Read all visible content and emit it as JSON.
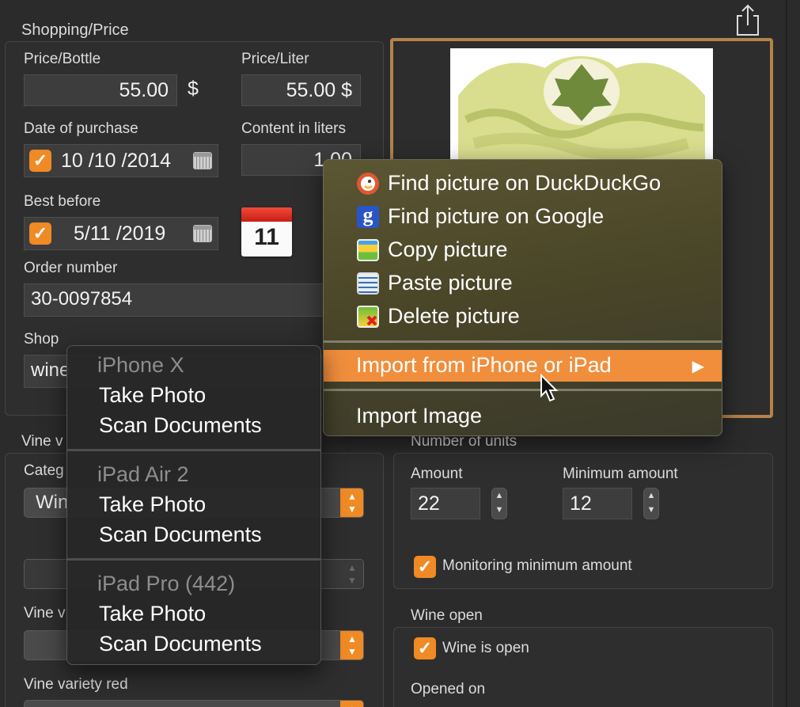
{
  "sections": {
    "shopping_price": "Shopping/Price",
    "vine": "Vine v",
    "number_of_units": "Number of units",
    "wine_open": "Wine open"
  },
  "fields": {
    "price_bottle_label": "Price/Bottle",
    "price_bottle_value": "55.00",
    "currency_symbol": "$",
    "price_liter_label": "Price/Liter",
    "price_liter_value": "55.00 $",
    "date_of_purchase_label": "Date of purchase",
    "date_of_purchase_value": "10 /10 /2014",
    "content_liters_label": "Content in liters",
    "content_liters_value": "1.00",
    "best_before_label": "Best before",
    "best_before_value": "5/11 /2019",
    "calendar_day": "11",
    "order_number_label": "Order number",
    "order_number_value": "30-0097854",
    "shop_label": "Shop",
    "shop_value": "wine",
    "category_label": "Categ",
    "category_value": "Win",
    "vine_v_label": "Vine v",
    "vine_variety_red_label": "Vine variety red",
    "amount_label": "Amount",
    "amount_value": "22",
    "min_amount_label": "Minimum amount",
    "min_amount_value": "12",
    "monitoring_label": "Monitoring minimum amount",
    "wine_is_open_label": "Wine is open",
    "opened_on_label": "Opened on"
  },
  "context_menu": {
    "items": [
      {
        "label": "Find picture on DuckDuckGo",
        "icon": "duckduckgo-icon"
      },
      {
        "label": "Find picture on Google",
        "icon": "google-icon"
      },
      {
        "label": "Copy picture",
        "icon": "copy-picture-icon"
      },
      {
        "label": "Paste picture",
        "icon": "paste-picture-icon"
      },
      {
        "label": "Delete picture",
        "icon": "delete-picture-icon"
      }
    ],
    "import_device": "Import from iPhone or iPad",
    "submenu_arrow": "▶",
    "import_image": "Import Image"
  },
  "device_menu": {
    "devices": [
      {
        "name": "iPhone X",
        "take_photo": "Take Photo",
        "scan_documents": "Scan Documents"
      },
      {
        "name": "iPad Air 2",
        "take_photo": "Take Photo",
        "scan_documents": "Scan Documents"
      },
      {
        "name": "iPad Pro (442)",
        "take_photo": "Take Photo",
        "scan_documents": "Scan Documents"
      }
    ]
  },
  "colors": {
    "accent": "#f08a24",
    "selected_menu_item": "#f08e3c",
    "picture_frame": "#b5824a",
    "background": "#2b2b2b"
  }
}
